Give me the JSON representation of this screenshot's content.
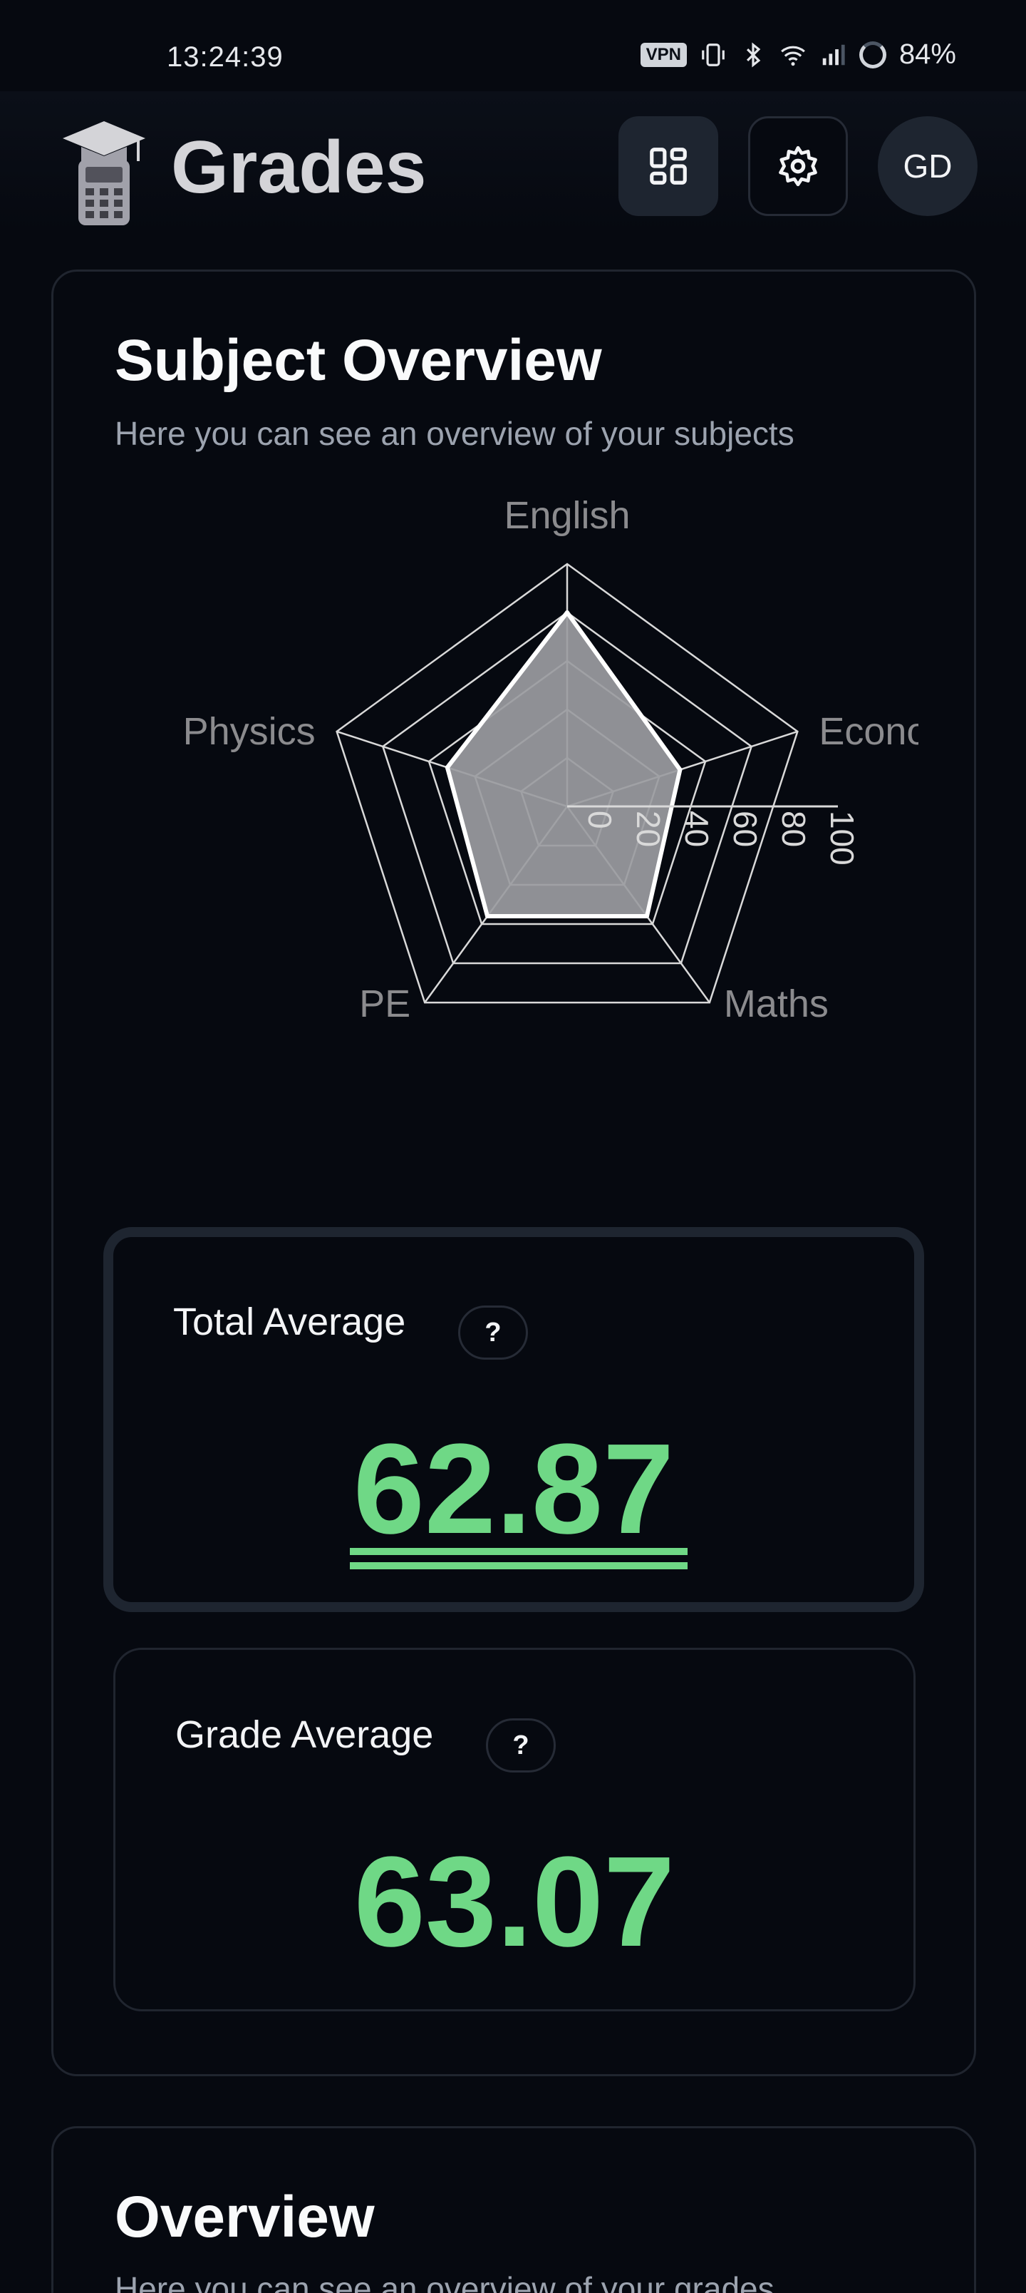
{
  "status_bar": {
    "time": "13:24:39",
    "vpn_label": "VPN",
    "battery": "84%",
    "icons": [
      "vibrate-icon",
      "bluetooth-icon",
      "wifi-icon",
      "signal-icon",
      "battery-icon"
    ]
  },
  "header": {
    "title": "Grades",
    "logo_icon": "graduation-calculator-icon",
    "dashboard_icon": "dashboard-grid-icon",
    "settings_icon": "gear-icon",
    "avatar_initials": "GD"
  },
  "subject_overview": {
    "title": "Subject Overview",
    "subtitle": "Here you can see an overview of your subjects"
  },
  "chart_data": {
    "type": "radar",
    "axes": [
      "English",
      "Econom",
      "Maths",
      "PE",
      "Physics"
    ],
    "values": [
      80,
      49,
      56,
      56,
      52
    ],
    "range": [
      0,
      100
    ],
    "tick_labels": [
      "0",
      "20",
      "40",
      "60",
      "80",
      "100"
    ],
    "grid": true,
    "colors": {
      "fill": "#9b9ca1",
      "stroke": "#ffffff",
      "grid": "#d9d9d9",
      "label": "#8b8b8e"
    }
  },
  "total_average": {
    "label": "Total Average",
    "help": "?",
    "value": "62.87"
  },
  "grade_average": {
    "label": "Grade Average",
    "help": "?",
    "value": "63.07"
  },
  "overview": {
    "title": "Overview",
    "subtitle": "Here you can see an overview of your grades"
  },
  "colors": {
    "background": "#060910",
    "accent_green": "#6fd886",
    "card_border": "#20252f"
  }
}
